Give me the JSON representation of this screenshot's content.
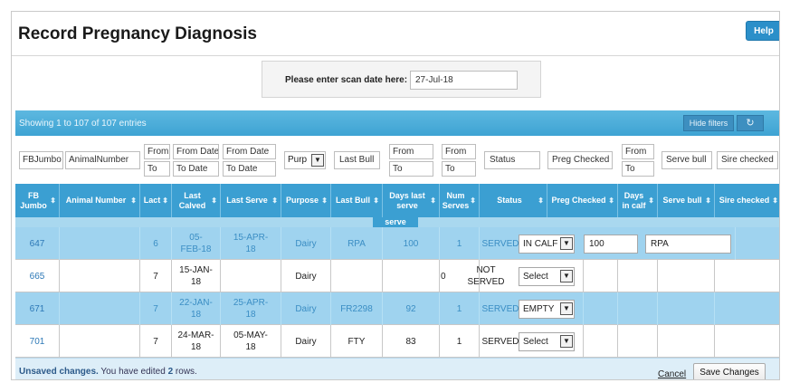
{
  "page": {
    "title": "Record Pregnancy Diagnosis",
    "help_label": "Help"
  },
  "scan": {
    "label": "Please enter scan date here:",
    "value": "27-Jul-18"
  },
  "table_info": {
    "showing": "Showing 1 to 107 of 107 entries",
    "hide_filters": "Hide filters",
    "refresh_icon": "↻"
  },
  "filters": {
    "fbjumbo": "FBJumbo",
    "animal_number": "AnimalNumber",
    "lact_from": "From",
    "lact_to": "To",
    "last_calved_from": "From Date",
    "last_calved_to": "To Date",
    "last_serve_from": "From Date",
    "last_serve_to": "To Date",
    "purpose": "Purp",
    "last_bull": "Last Bull",
    "days_from": "From",
    "days_to": "To",
    "num_from": "From",
    "num_to": "To",
    "status": "Status",
    "preg_checked": "Preg Checked",
    "days_in_calf_from": "From",
    "days_in_calf_to": "To",
    "serve_bull": "Serve bull",
    "sire_checked": "Sire checked"
  },
  "columns": {
    "fb_jumbo": "FB Jumbo",
    "animal_number": "Animal Number",
    "lact": "Lact",
    "last_calved": "Last Calved",
    "last_serve": "Last Serve",
    "purpose": "Purpose",
    "last_bull": "Last Bull",
    "days_last_serve": "Days last serve",
    "days_last_serve_extra": "serve",
    "num_serves": "Num Serves",
    "status": "Status",
    "preg_checked": "Preg Checked",
    "days_in_calf": "Days in calf",
    "serve_bull": "Serve bull",
    "sire_checked": "Sire checked",
    "sort_icon": "⬍"
  },
  "rows": [
    {
      "fb": "647",
      "animal": "",
      "lact": "6",
      "calved": "05-FEB-18",
      "serve": "15-APR-18",
      "purpose": "Dairy",
      "bull": "RPA",
      "days": "100",
      "num": "1",
      "served": "SERVED",
      "status": "IN CALF",
      "preg": "100",
      "serve_bull": "RPA",
      "sire": ""
    },
    {
      "fb": "665",
      "animal": "",
      "lact": "7",
      "calved": "15-JAN-18",
      "serve": "",
      "purpose": "Dairy",
      "bull": "",
      "days": "",
      "num": "0",
      "served": "NOT SERVED",
      "status": "Select",
      "preg": "",
      "serve_bull": "",
      "sire": ""
    },
    {
      "fb": "671",
      "animal": "",
      "lact": "7",
      "calved": "22-JAN-18",
      "serve": "25-APR-18",
      "purpose": "Dairy",
      "bull": "FR2298",
      "days": "92",
      "num": "1",
      "served": "SERVED",
      "status": "EMPTY",
      "preg": "",
      "serve_bull": "",
      "sire": ""
    },
    {
      "fb": "701",
      "animal": "",
      "lact": "7",
      "calved": "24-MAR-18",
      "serve": "05-MAY-18",
      "purpose": "Dairy",
      "bull": "FTY",
      "days": "83",
      "num": "1",
      "served": "SERVED",
      "status": "Select",
      "preg": "",
      "serve_bull": "",
      "sire": ""
    }
  ],
  "footer": {
    "unsaved": "Unsaved changes.",
    "edited_prefix": "You have edited",
    "edited_count": "2",
    "edited_suffix": "rows.",
    "cancel": "Cancel",
    "save": "Save Changes"
  }
}
